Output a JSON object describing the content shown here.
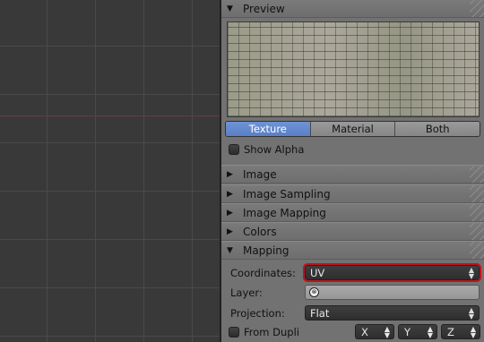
{
  "preview": {
    "header": "Preview",
    "tabs": [
      {
        "label": "Texture",
        "active": true
      },
      {
        "label": "Material",
        "active": false
      },
      {
        "label": "Both",
        "active": false
      }
    ],
    "show_alpha_label": "Show Alpha",
    "show_alpha_checked": false
  },
  "sections": {
    "image": "Image",
    "image_sampling": "Image Sampling",
    "image_mapping": "Image Mapping",
    "colors": "Colors",
    "mapping": "Mapping"
  },
  "mapping": {
    "coordinates_label": "Coordinates:",
    "coordinates_value": "UV",
    "layer_label": "Layer:",
    "layer_value": "",
    "projection_label": "Projection:",
    "projection_value": "Flat",
    "from_dupli_label": "From Dupli",
    "from_dupli_checked": false,
    "axes": [
      "X",
      "Y",
      "Z"
    ]
  },
  "colors": {
    "active_tab": "#5a7fc6",
    "highlight_outline": "#c0121c",
    "panel_bg": "#727272",
    "viewport_bg": "#393939"
  },
  "icons": {
    "expanded": "triangle-down-icon",
    "collapsed": "triangle-right-icon",
    "uv_layer": "uv-map-icon",
    "dropdown": "up-down-arrows-icon"
  }
}
